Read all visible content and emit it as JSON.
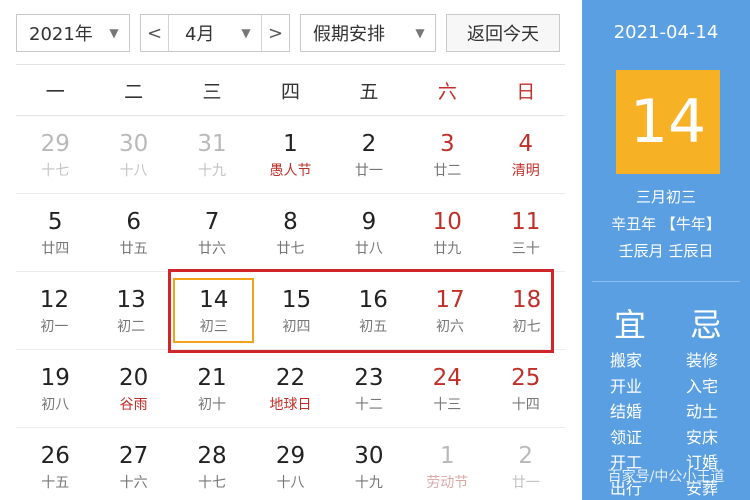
{
  "toolbar": {
    "year": "2021年",
    "prev_arrow": "<",
    "month": "4月",
    "next_arrow": ">",
    "holiday": "假期安排",
    "today": "返回今天"
  },
  "weekdays": [
    "一",
    "二",
    "三",
    "四",
    "五",
    "六",
    "日"
  ],
  "weeks": [
    [
      {
        "num": "29",
        "sub": "十七"
      },
      {
        "num": "30",
        "sub": "十八"
      },
      {
        "num": "31",
        "sub": "十九"
      },
      {
        "num": "1",
        "sub": "愚人节"
      },
      {
        "num": "2",
        "sub": "廿一"
      },
      {
        "num": "3",
        "sub": "廿二"
      },
      {
        "num": "4",
        "sub": "清明"
      }
    ],
    [
      {
        "num": "5",
        "sub": "廿四"
      },
      {
        "num": "6",
        "sub": "廿五"
      },
      {
        "num": "7",
        "sub": "廿六"
      },
      {
        "num": "8",
        "sub": "廿七"
      },
      {
        "num": "9",
        "sub": "廿八"
      },
      {
        "num": "10",
        "sub": "廿九"
      },
      {
        "num": "11",
        "sub": "三十"
      }
    ],
    [
      {
        "num": "12",
        "sub": "初一"
      },
      {
        "num": "13",
        "sub": "初二"
      },
      {
        "num": "14",
        "sub": "初三"
      },
      {
        "num": "15",
        "sub": "初四"
      },
      {
        "num": "16",
        "sub": "初五"
      },
      {
        "num": "17",
        "sub": "初六"
      },
      {
        "num": "18",
        "sub": "初七"
      }
    ],
    [
      {
        "num": "19",
        "sub": "初八"
      },
      {
        "num": "20",
        "sub": "谷雨"
      },
      {
        "num": "21",
        "sub": "初十"
      },
      {
        "num": "22",
        "sub": "地球日"
      },
      {
        "num": "23",
        "sub": "十二"
      },
      {
        "num": "24",
        "sub": "十三"
      },
      {
        "num": "25",
        "sub": "十四"
      }
    ],
    [
      {
        "num": "26",
        "sub": "十五"
      },
      {
        "num": "27",
        "sub": "十六"
      },
      {
        "num": "28",
        "sub": "十七"
      },
      {
        "num": "29",
        "sub": "十八"
      },
      {
        "num": "30",
        "sub": "十九"
      },
      {
        "num": "1",
        "sub": "劳动节"
      },
      {
        "num": "2",
        "sub": "廿一"
      }
    ]
  ],
  "panel": {
    "date": "2021-04-14",
    "day": "14",
    "lunar": "三月初三",
    "ganzhi_year": "辛丑年 【牛年】",
    "ganzhi_month_day": "壬辰月 壬辰日",
    "yi_title": "宜",
    "ji_title": "忌",
    "yi": [
      "搬家",
      "开业",
      "结婚",
      "领证",
      "开工",
      "出行"
    ],
    "ji": [
      "装修",
      "入宅",
      "动土",
      "安床",
      "订婚",
      "安葬"
    ]
  },
  "watermark": "百家号/中公小王道",
  "colors": {
    "panel_bg": "#5b9fe3",
    "day_box": "#f7b125",
    "highlight_border": "#d0262b",
    "selected_border": "#f3a31a",
    "weekend_red": "#c0302a"
  }
}
